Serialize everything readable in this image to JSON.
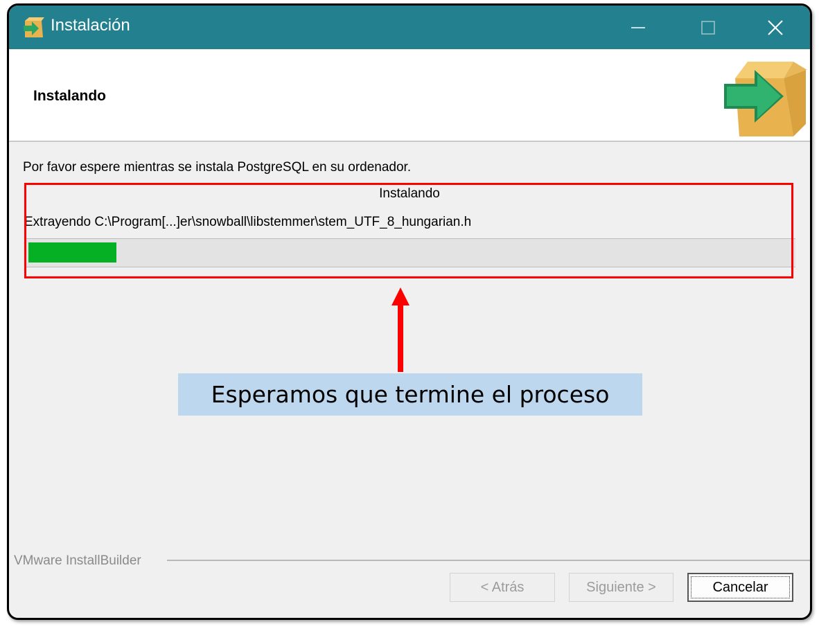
{
  "window": {
    "title": "Instalación",
    "controls": [
      "minimize",
      "maximize",
      "close"
    ]
  },
  "header": {
    "title": "Instalando",
    "icon": "package-arrow-icon"
  },
  "body": {
    "description": "Por favor espere mientras se instala PostgreSQL en su ordenador.",
    "progress": {
      "title": "Instalando",
      "path": "Extrayendo C:\\Program[...]er\\snowball\\libstemmer\\stem_UTF_8_hungarian.h",
      "fraction": 0.115,
      "fill_color": "#06b025"
    }
  },
  "annotation": {
    "callout": "Esperamos que termine el proceso",
    "highlight_color": "#ff0000",
    "callout_background": "#bdd7ee"
  },
  "footer": {
    "brand": "VMware InstallBuilder",
    "buttons": {
      "back": "< Atrás",
      "next": "Siguiente >",
      "cancel": "Cancelar"
    }
  },
  "colors": {
    "titlebar": "#23808f"
  }
}
